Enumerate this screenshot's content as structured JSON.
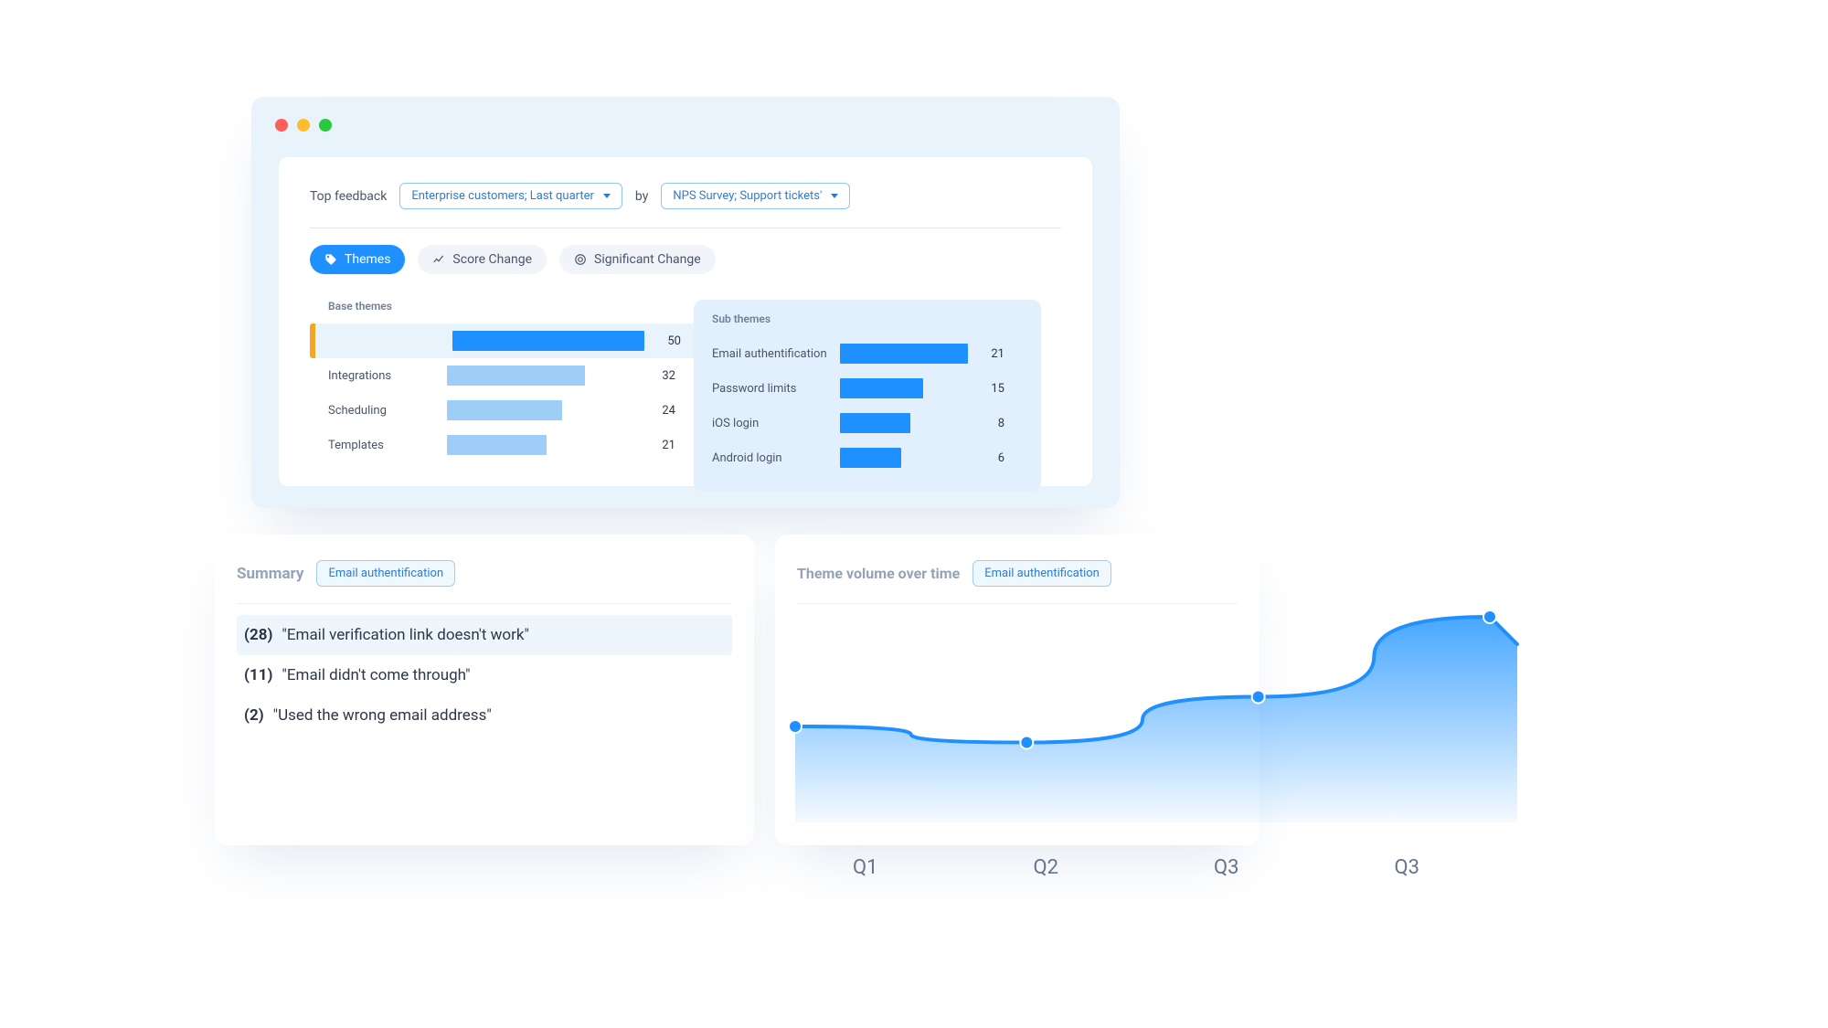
{
  "filters": {
    "label_left": "Top feedback",
    "segment_select": "Enterprise customers; Last quarter",
    "label_mid": "by",
    "source_select": "NPS Survey; Support tickets'"
  },
  "tabs": {
    "themes": "Themes",
    "score_change": "Score Change",
    "significant_change": "Significant Change"
  },
  "base_themes": {
    "header": "Base themes",
    "rows": [
      {
        "label": "",
        "value": 50,
        "selected": true
      },
      {
        "label": "Integrations",
        "value": 32
      },
      {
        "label": "Scheduling",
        "value": 24
      },
      {
        "label": "Templates",
        "value": 21
      }
    ]
  },
  "sub_themes": {
    "header": "Sub themes",
    "rows": [
      {
        "label": "Email authentification",
        "value": 21
      },
      {
        "label": "Password limits",
        "value": 15
      },
      {
        "label": "iOS login",
        "value": 8
      },
      {
        "label": "Android login",
        "value": 6
      }
    ]
  },
  "summary": {
    "title": "Summary",
    "chip": "Email authentification",
    "items": [
      {
        "count": "(28)",
        "text": "\"Email verification link doesn't work\"",
        "hl": true
      },
      {
        "count": "(11)",
        "text": "\"Email didn't come through\""
      },
      {
        "count": "(2)",
        "text": "\"Used the wrong email address\""
      }
    ]
  },
  "chart_card": {
    "title": "Theme volume over time",
    "chip": "Email authentification"
  },
  "chart_data": {
    "type": "area",
    "title": "Theme volume over time",
    "series_name": "Email authentification",
    "categories": [
      "Q1",
      "Q2",
      "Q3",
      "Q3"
    ],
    "values": [
      42,
      35,
      55,
      90
    ],
    "ylim": [
      0,
      100
    ],
    "xlabel": "",
    "ylabel": ""
  },
  "colors": {
    "primary": "#1e90ff",
    "light_bar": "#9ecdf8",
    "accent_orange": "#f5a623"
  }
}
